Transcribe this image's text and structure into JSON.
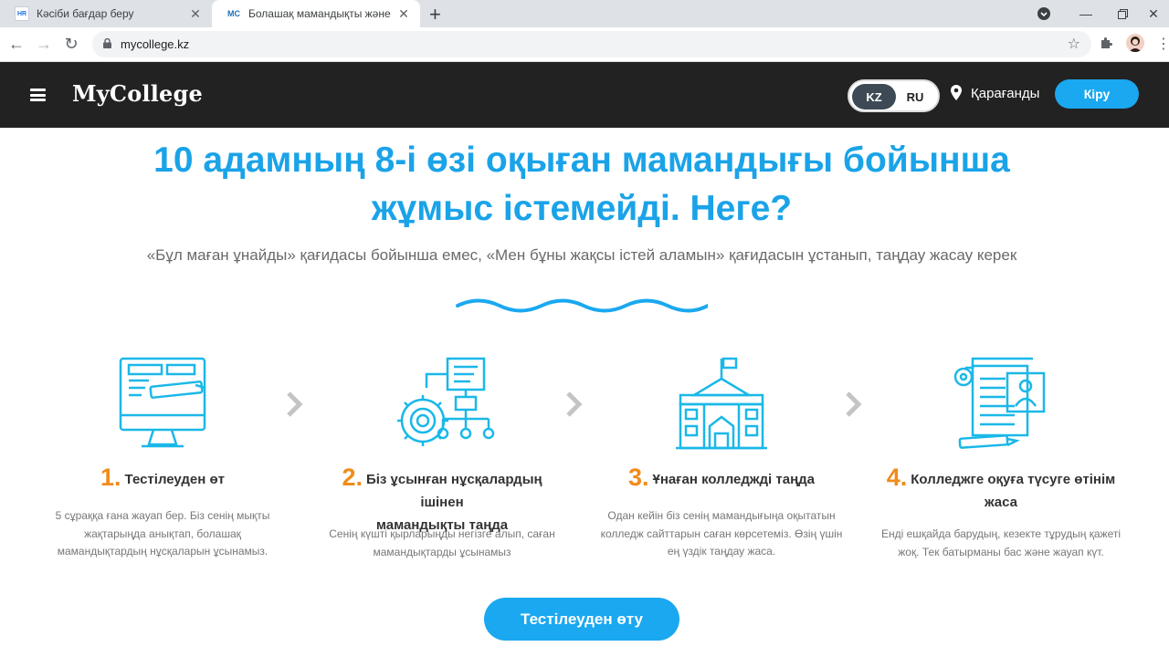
{
  "browser": {
    "tabs": [
      {
        "favicon": "HR",
        "title": "Кәсіби бағдар беру"
      },
      {
        "favicon": "MC",
        "title": "Болашақ мамандықты және кол"
      }
    ],
    "url": "mycollege.kz"
  },
  "header": {
    "logo": "MyCollege",
    "lang_kz": "KZ",
    "lang_ru": "RU",
    "city": "Қарағанды",
    "login": "Кіру"
  },
  "hero": {
    "title_line1": "10 адамның 8-і өзі оқыған мамандығы бойынша",
    "title_line2": "жұмыс істемейді. Неге?",
    "subtitle": "«Бұл маған ұнайды» қағидасы бойынша емес, «Мен бұны жақсы істей аламын» қағидасын ұстанып, таңдау жасау керек"
  },
  "steps": [
    {
      "num": "1.",
      "title": "Тестілеуден өт",
      "desc": [
        "5 сұраққа ғана жауап бер. Біз сенің мықты",
        "жақтарыңда анықтап, болашақ",
        "мамандықтардың нұсқаларын ұсынамыз."
      ],
      "icon": "computer-test-icon"
    },
    {
      "num": "2.",
      "title": "Біз ұсынған нұсқалардың ішінен",
      "title2": "мамандықты таңда",
      "desc": [
        "Сенің күшті қырларыңды негізге алып, саған",
        "мамандықтарды ұсынамыз"
      ],
      "icon": "gear-flowchart-icon"
    },
    {
      "num": "3.",
      "title": "Ұнаған колледжді таңда",
      "desc": [
        "Одан кейін біз сенің мамандығыңа оқытатын",
        "колледж сайттарын саған көрсетеміз. Өзің үшін",
        "ең үздік таңдау жаса."
      ],
      "icon": "college-building-icon"
    },
    {
      "num": "4.",
      "title": "Колледжге оқуға түсуге өтінім",
      "title2": "жаса",
      "desc": [
        "Енді ешқайда барудың, кезекте тұрудың қажеті",
        "жоқ. Тек батырманы бас және жауап күт."
      ],
      "icon": "application-documents-icon"
    }
  ],
  "cta": "Тестілеуден өту",
  "colors": {
    "accent": "#1aa3e8",
    "number": "#f08c1a",
    "header_bg": "#222222"
  }
}
